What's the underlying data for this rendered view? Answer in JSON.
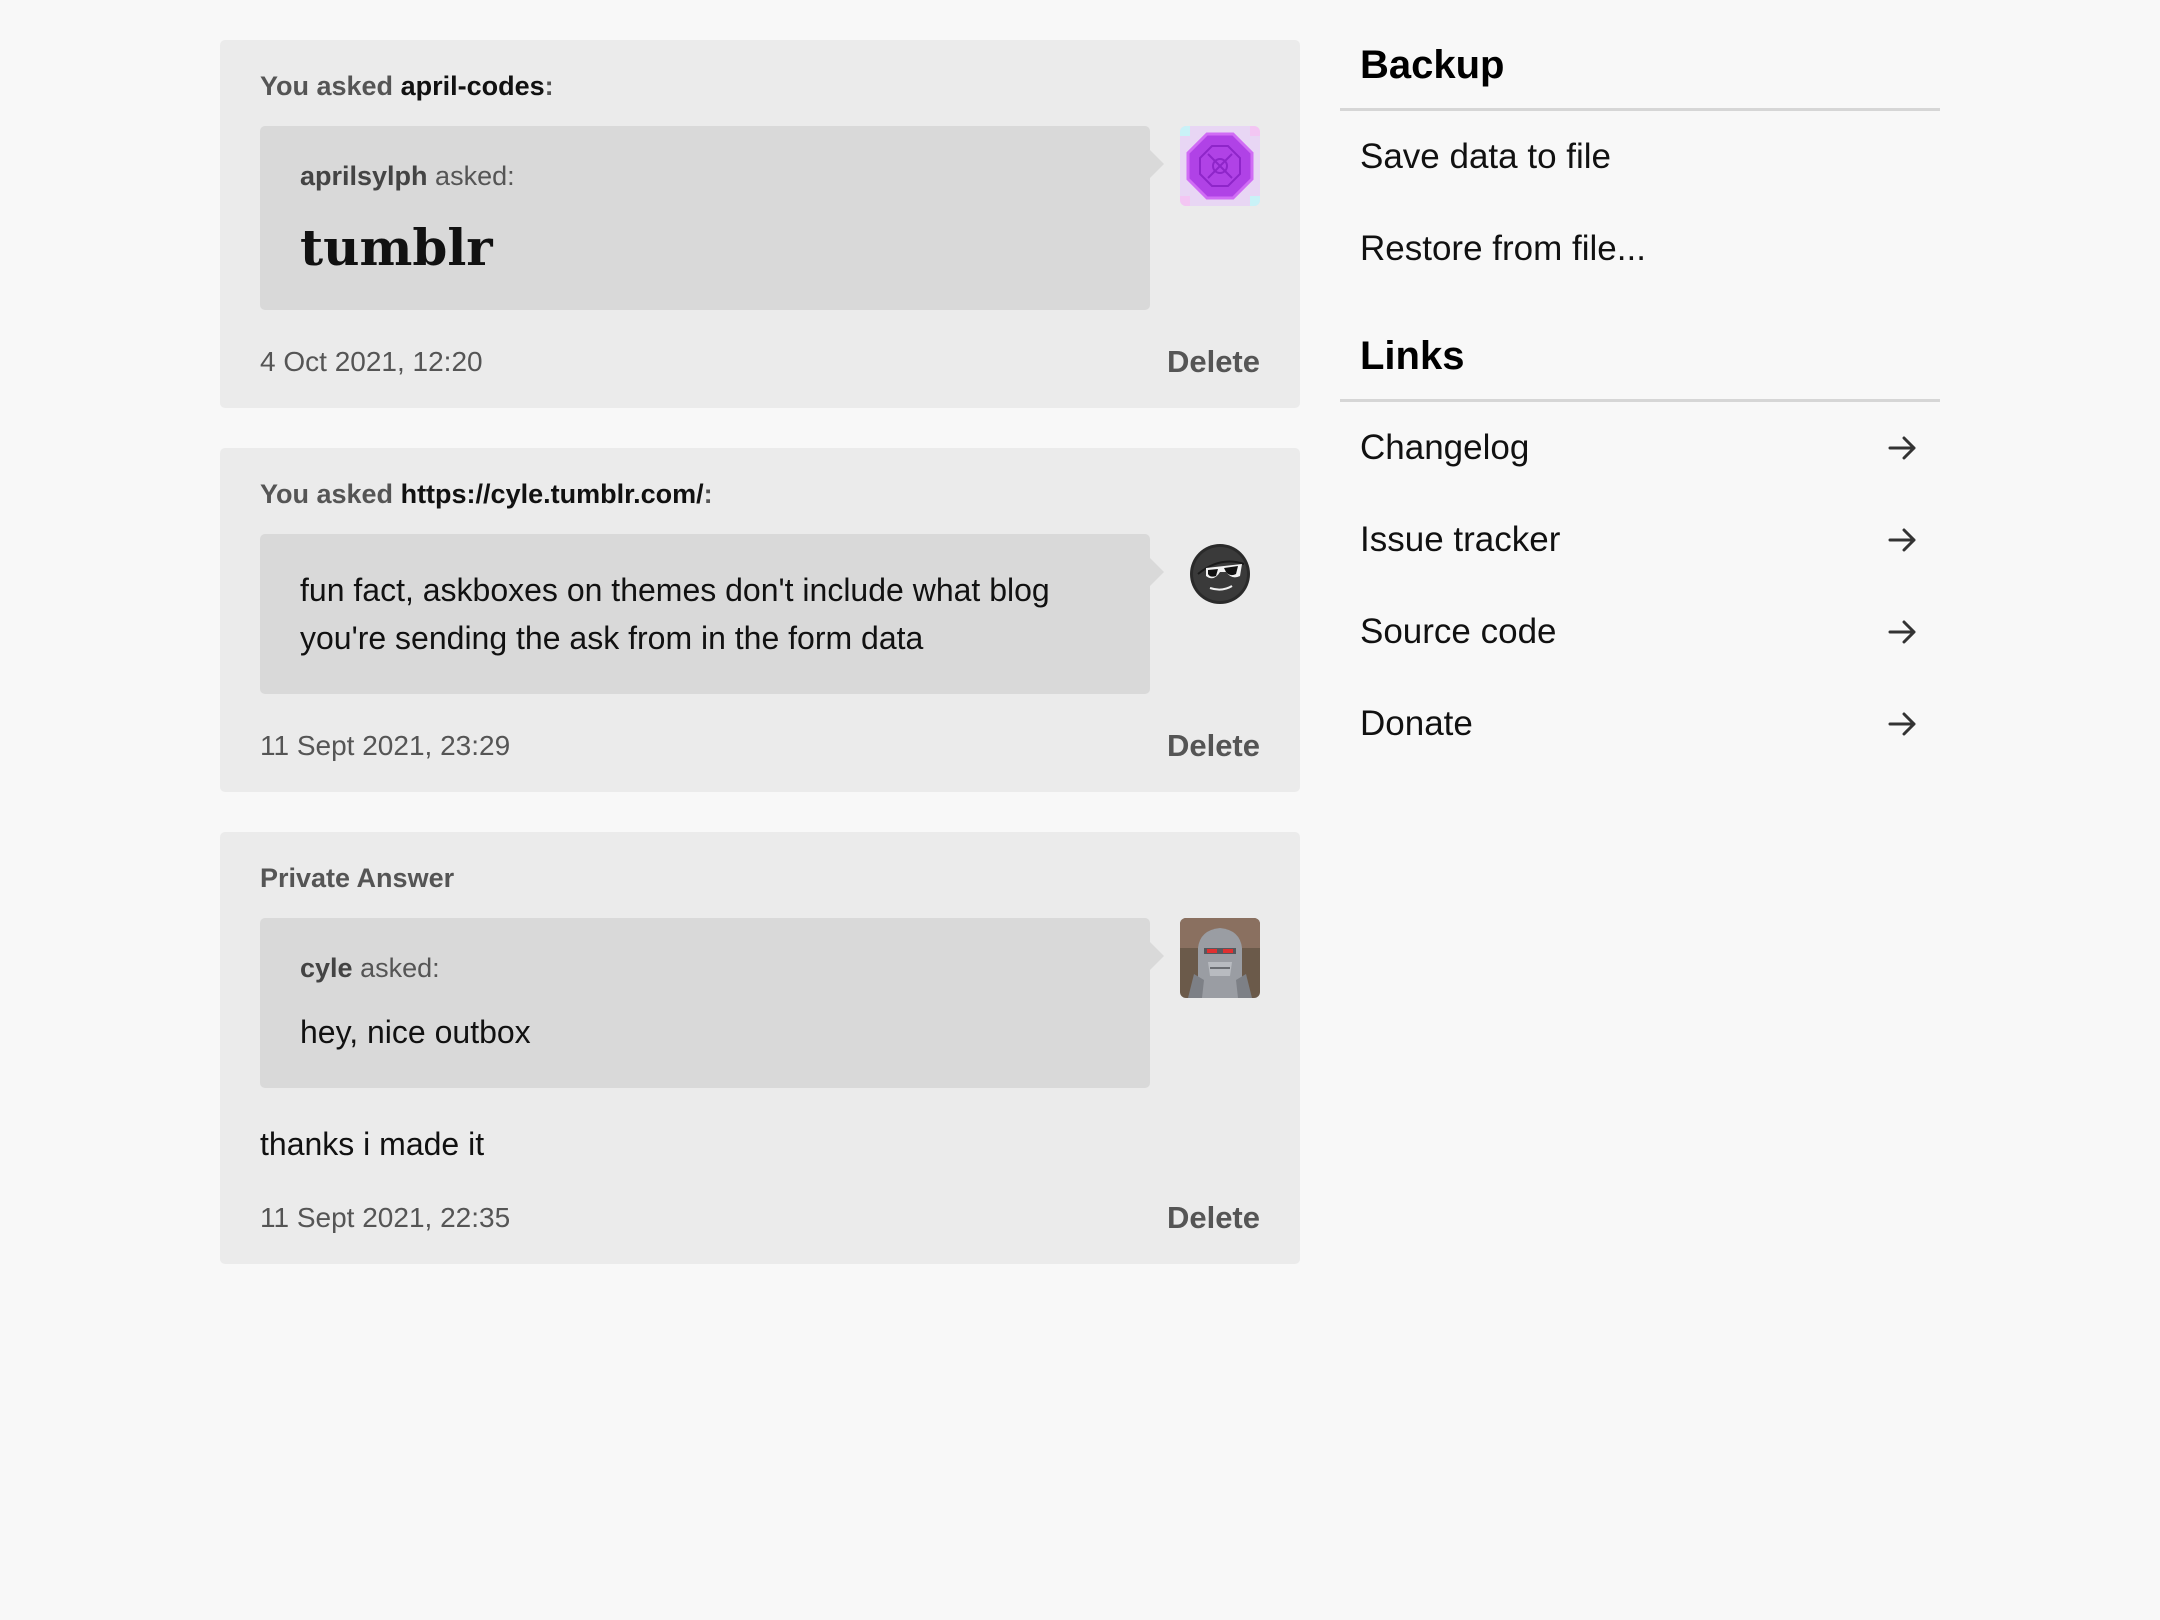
{
  "posts": [
    {
      "header_prefix": "You asked",
      "header_target": "april-codes",
      "header_suffix": ":",
      "asker": "aprilsylph",
      "asked_label": " asked:",
      "ask_text": "tumblr",
      "avatar_icon": "purple-octagon-avatar",
      "timestamp": "4 Oct 2021, 12:20",
      "delete_label": "Delete"
    },
    {
      "header_prefix": "You asked",
      "header_target": "https://cyle.tumblr.com/",
      "header_suffix": ":",
      "ask_text": "fun fact, askboxes on themes don't include what blog you're sending the ask from in the form data",
      "avatar_icon": "sunglasses-face-avatar",
      "timestamp": "11 Sept 2021, 23:29",
      "delete_label": "Delete"
    },
    {
      "header": "Private Answer",
      "asker": "cyle",
      "asked_label": " asked:",
      "ask_text": "hey, nice outbox",
      "answer_text": "thanks i made it",
      "avatar_icon": "robot-avatar",
      "timestamp": "11 Sept 2021, 22:35",
      "delete_label": "Delete"
    }
  ],
  "sidebar": {
    "backup": {
      "heading": "Backup",
      "items": [
        "Save data to file",
        "Restore from file..."
      ]
    },
    "links": {
      "heading": "Links",
      "items": [
        "Changelog",
        "Issue tracker",
        "Source code",
        "Donate"
      ],
      "item_icon": "arrow-right-icon"
    }
  },
  "colors": {
    "page_bg": "#f8f8f8",
    "card_bg": "#ebebeb",
    "bubble_bg": "#d9d9d9",
    "muted_text": "#555555"
  }
}
